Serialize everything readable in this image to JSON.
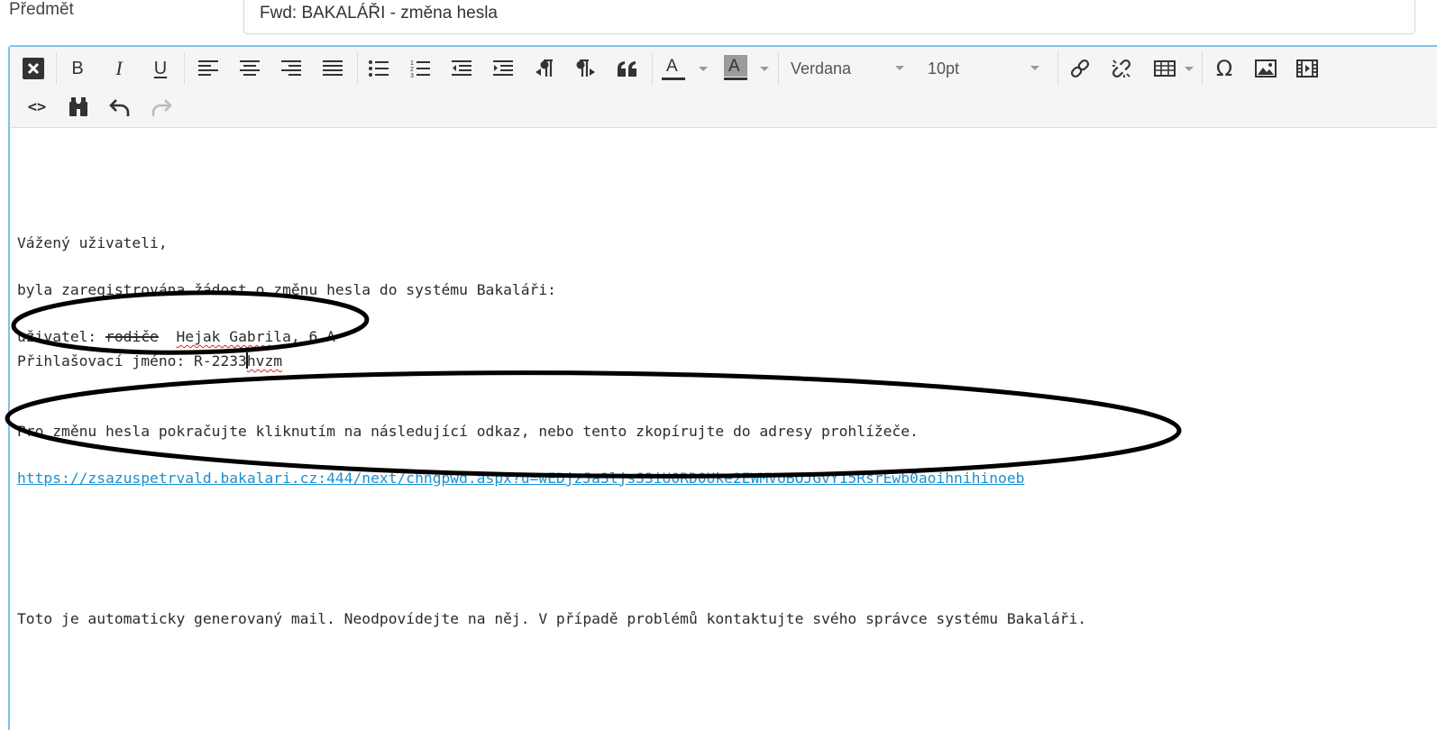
{
  "subject": {
    "label": "Předmět",
    "value": "Fwd: BAKALÁŘI - změna hesla"
  },
  "toolbar": {
    "font_family": "Verdana",
    "font_size": "10pt",
    "bold_label": "B",
    "italic_label": "I",
    "underline_label": "U",
    "text_color_label": "A",
    "bg_color_label": "A",
    "source_label": "<>",
    "special_char_label": "Ω"
  },
  "body": {
    "greeting": "Vážený uživateli,",
    "intro": "byla zaregistrována žádost o změnu hesla do systému Bakaláři:",
    "user_line_prefix": "uživatel: ",
    "user_line_struck": "rodiče",
    "user_line_gap": "  ",
    "user_line_name": "Hejak Gabrila",
    "user_line_suffix": ", 6.A",
    "login_prefix": "Přihlašovací jméno: R-2233",
    "login_suffix": "hvzm",
    "instruction": "Pro změnu hesla pokračujte kliknutím na následující odkaz, nebo tento zkopírujte do adresy prohlížeče.",
    "link": "https://zsazuspetrvald.bakalari.cz:444/next/chngpwd.aspx?u=wEDjzJa3ljsS3iU0RD0Uke2EWMVoBOJGvY15RsrEwb0aoihnihinoeb",
    "footer": "Toto je automaticky generovaný mail. Neodpovídejte na něj. V případě problémů kontaktujte svého správce systému Bakaláři."
  },
  "colors": {
    "editor_border": "#7fc2ea",
    "link": "#1a8fd1",
    "annotation": "#000000"
  }
}
